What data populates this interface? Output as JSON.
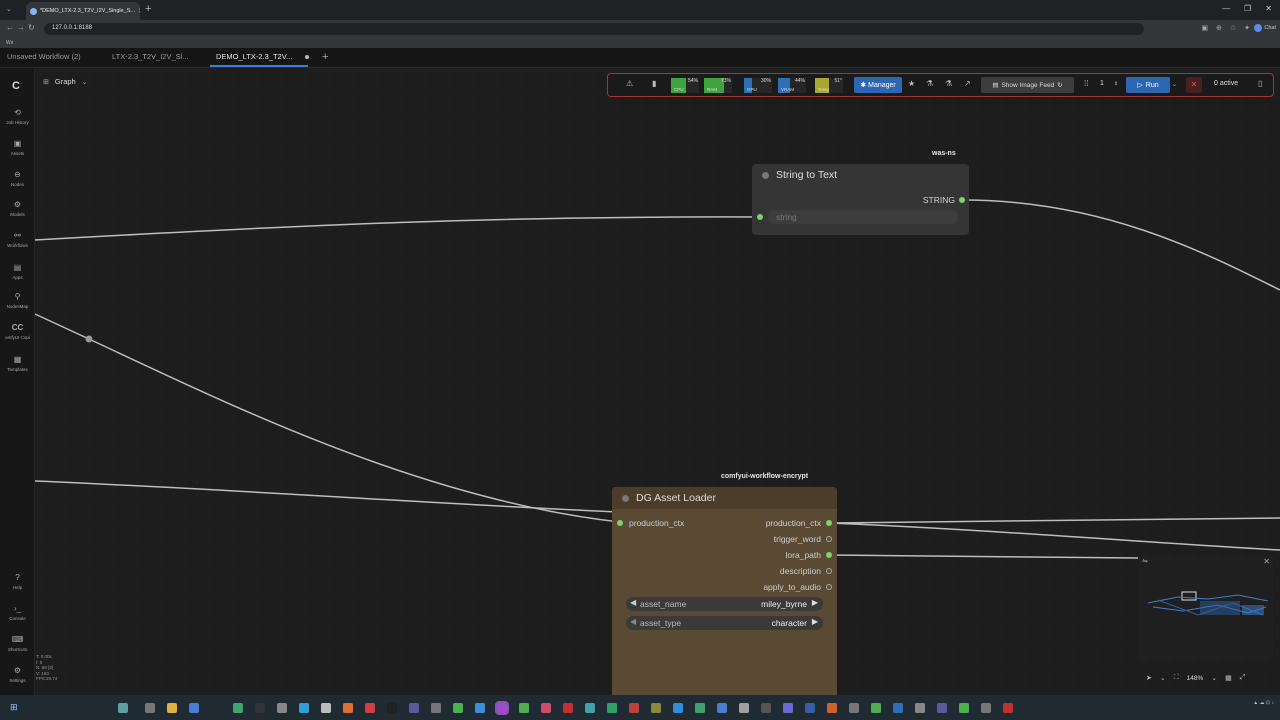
{
  "browser": {
    "tab_title": "*DEMO_LTX-2.3_T2V_I2V_Single_S...",
    "address": "127.0.0.1:8188",
    "bookmark": "Ws",
    "profile": "Chat"
  },
  "workflow_tabs": [
    {
      "label": "Unsaved Workflow (2)"
    },
    {
      "label": "LTX-2.3_T2V_I2V_Sl..."
    },
    {
      "label": "DEMO_LTX-2.3_T2V..."
    }
  ],
  "graph_menu": {
    "label": "Graph"
  },
  "sidebar": {
    "items": [
      {
        "label": "Job History",
        "icon": "history-icon"
      },
      {
        "label": "Assets",
        "icon": "image-icon"
      },
      {
        "label": "Nodes",
        "icon": "nodes-icon"
      },
      {
        "label": "Models",
        "icon": "models-icon"
      },
      {
        "label": "Workflows",
        "icon": "workflow-icon"
      },
      {
        "label": "Apps",
        "icon": "apps-icon"
      },
      {
        "label": "NodesMap",
        "icon": "nodesmap-icon"
      },
      {
        "label": "omfyUI Copi",
        "icon": "copilot-icon"
      },
      {
        "label": "Templates",
        "icon": "templates-icon"
      }
    ],
    "bottom": [
      {
        "label": "Help",
        "icon": "help-icon"
      },
      {
        "label": "Console",
        "icon": "terminal-icon"
      },
      {
        "label": "Shortcuts",
        "icon": "keyboard-icon"
      },
      {
        "label": "Settings",
        "icon": "gear-icon"
      }
    ]
  },
  "toolbar": {
    "meters": [
      {
        "label": "CPU",
        "value": "54%",
        "color": "#3fa33f"
      },
      {
        "label": "RAM",
        "value": "73%",
        "color": "#3fa33f"
      },
      {
        "label": "GPU",
        "value": "30%",
        "color": "#2f6fb8"
      },
      {
        "label": "VRAM",
        "value": "44%",
        "color": "#2f6fb8"
      },
      {
        "label": "Temp",
        "value": "51°",
        "color": "#a8a830"
      }
    ],
    "manager_label": "Manager",
    "feed_label": "Show Image Feed",
    "queue_count": "1",
    "run_label": "Run",
    "active_label": "0 active"
  },
  "nodes": {
    "string_to_text": {
      "badge": "was-ns",
      "title": "String to Text",
      "output": "STRING",
      "input": "string"
    },
    "dg_asset_loader": {
      "badge": "comfyui-workflow-encrypt",
      "title": "DG Asset Loader",
      "input": "production_ctx",
      "outputs": [
        "production_ctx",
        "trigger_word",
        "lora_path",
        "description",
        "apply_to_audio"
      ],
      "widgets": [
        {
          "name": "asset_name",
          "value": "miley_byrne"
        },
        {
          "name": "asset_type",
          "value": "character"
        }
      ]
    }
  },
  "zoom": "148%",
  "stats": [
    "T: 0.00s",
    "I: 0",
    "N: 68 [3]",
    "V: 183",
    "FPS:29.74"
  ],
  "colors": {
    "accent": "#2c67b3",
    "node_body_dark": "#353535",
    "node_body_loader": "#5b4a33",
    "link_green": "#7bd46a"
  }
}
